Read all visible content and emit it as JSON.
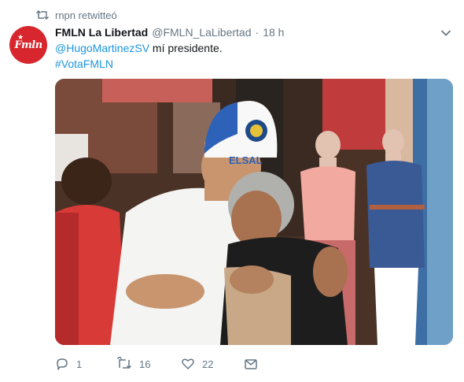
{
  "retweet_context": {
    "icon": "retweet-icon",
    "text": "rnpn retwitteó"
  },
  "tweet": {
    "avatar": {
      "text": "Fmln",
      "brand_color": "#d7262d"
    },
    "author_name": "FMLN La Libertad",
    "author_handle": "@FMLN_LaLibertad",
    "separator": "·",
    "timestamp": "18 h",
    "mention": "@HugoMartinezSV",
    "text": " mí presidente.",
    "hashtag": "#VotaFMLN",
    "link_color": "#1b95e0",
    "media": {
      "cap_text": "ELSAL"
    }
  },
  "actions": {
    "reply_count": "1",
    "retweet_count": "16",
    "like_count": "22",
    "icons": [
      "reply-icon",
      "retweet-icon",
      "like-icon",
      "message-icon"
    ]
  }
}
